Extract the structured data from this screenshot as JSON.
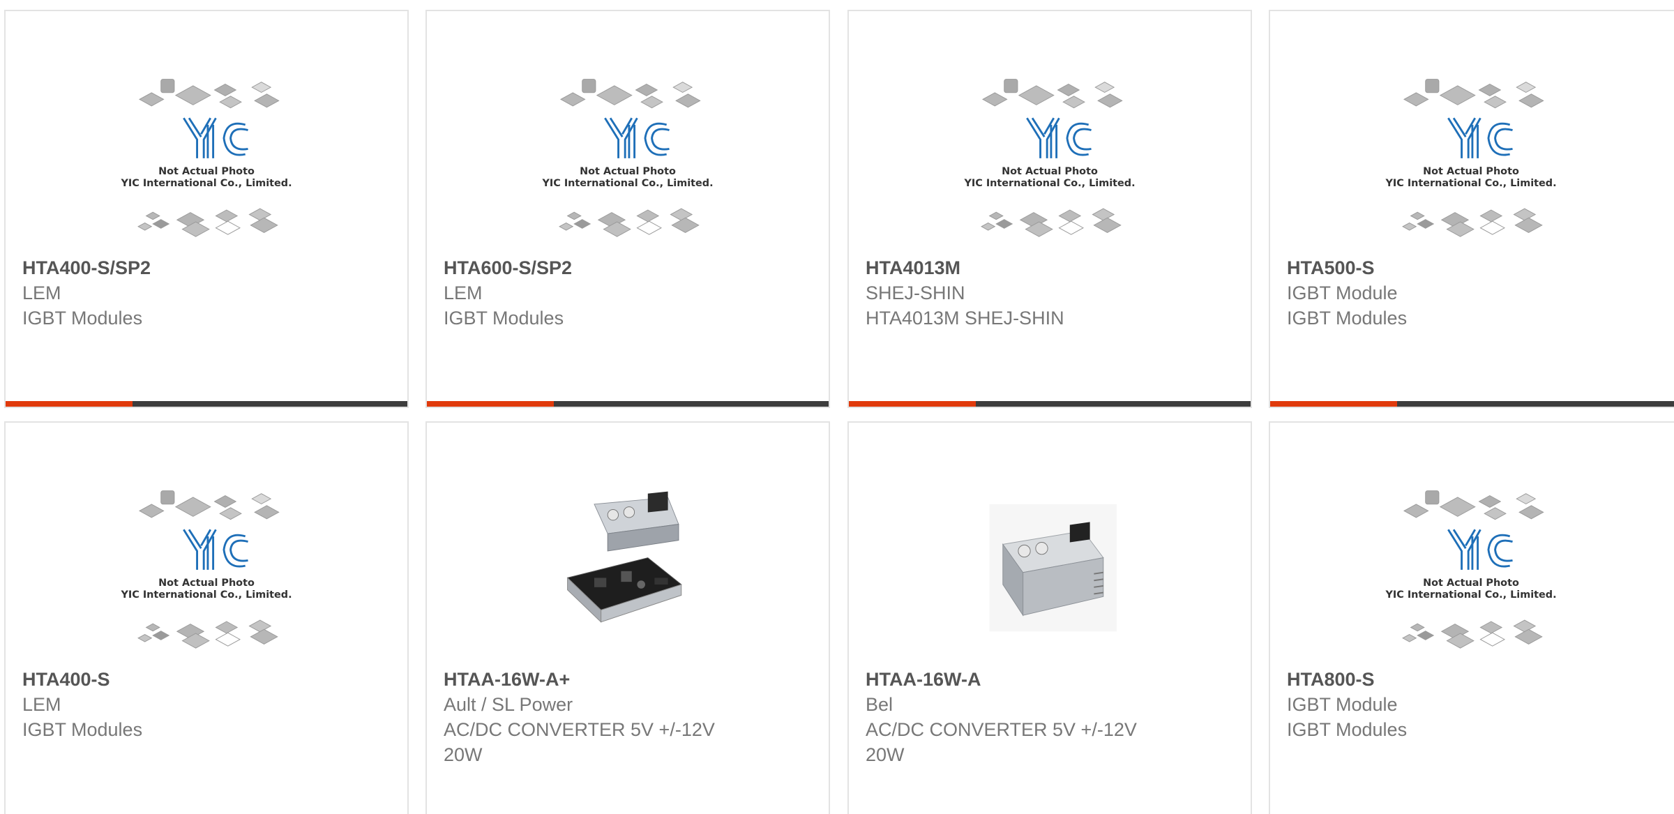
{
  "placeholder": {
    "caption_line1": "Not Actual Photo",
    "caption_line2": "YIC International Co., Limited.",
    "logo_text": "YIC"
  },
  "products": [
    {
      "part": "HTA400-S/SP2",
      "brand": "LEM",
      "desc1": "IGBT Modules",
      "desc2": "",
      "image": "placeholder"
    },
    {
      "part": "HTA600-S/SP2",
      "brand": "LEM",
      "desc1": "IGBT Modules",
      "desc2": "",
      "image": "placeholder"
    },
    {
      "part": "HTA4013M",
      "brand": "SHEJ-SHIN",
      "desc1": "HTA4013M SHEJ-SHIN",
      "desc2": "",
      "image": "placeholder"
    },
    {
      "part": "HTA500-S",
      "brand": "IGBT Module",
      "desc1": "IGBT Modules",
      "desc2": "",
      "image": "placeholder"
    },
    {
      "part": "HTA400-S",
      "brand": "LEM",
      "desc1": "IGBT Modules",
      "desc2": "",
      "image": "placeholder"
    },
    {
      "part": "HTAA-16W-A+",
      "brand": "Ault / SL Power",
      "desc1": "AC/DC CONVERTER 5V +/-12V",
      "desc2": "20W",
      "image": "power-supply-open"
    },
    {
      "part": "HTAA-16W-A",
      "brand": "Bel",
      "desc1": "AC/DC CONVERTER 5V +/-12V",
      "desc2": "20W",
      "image": "power-supply-closed"
    },
    {
      "part": "HTA800-S",
      "brand": "IGBT Module",
      "desc1": "IGBT Modules",
      "desc2": "",
      "image": "placeholder"
    }
  ],
  "colors": {
    "accent": "#e03a0c",
    "bar": "#3d3d3d",
    "logo_blue": "#1e6fb8"
  }
}
